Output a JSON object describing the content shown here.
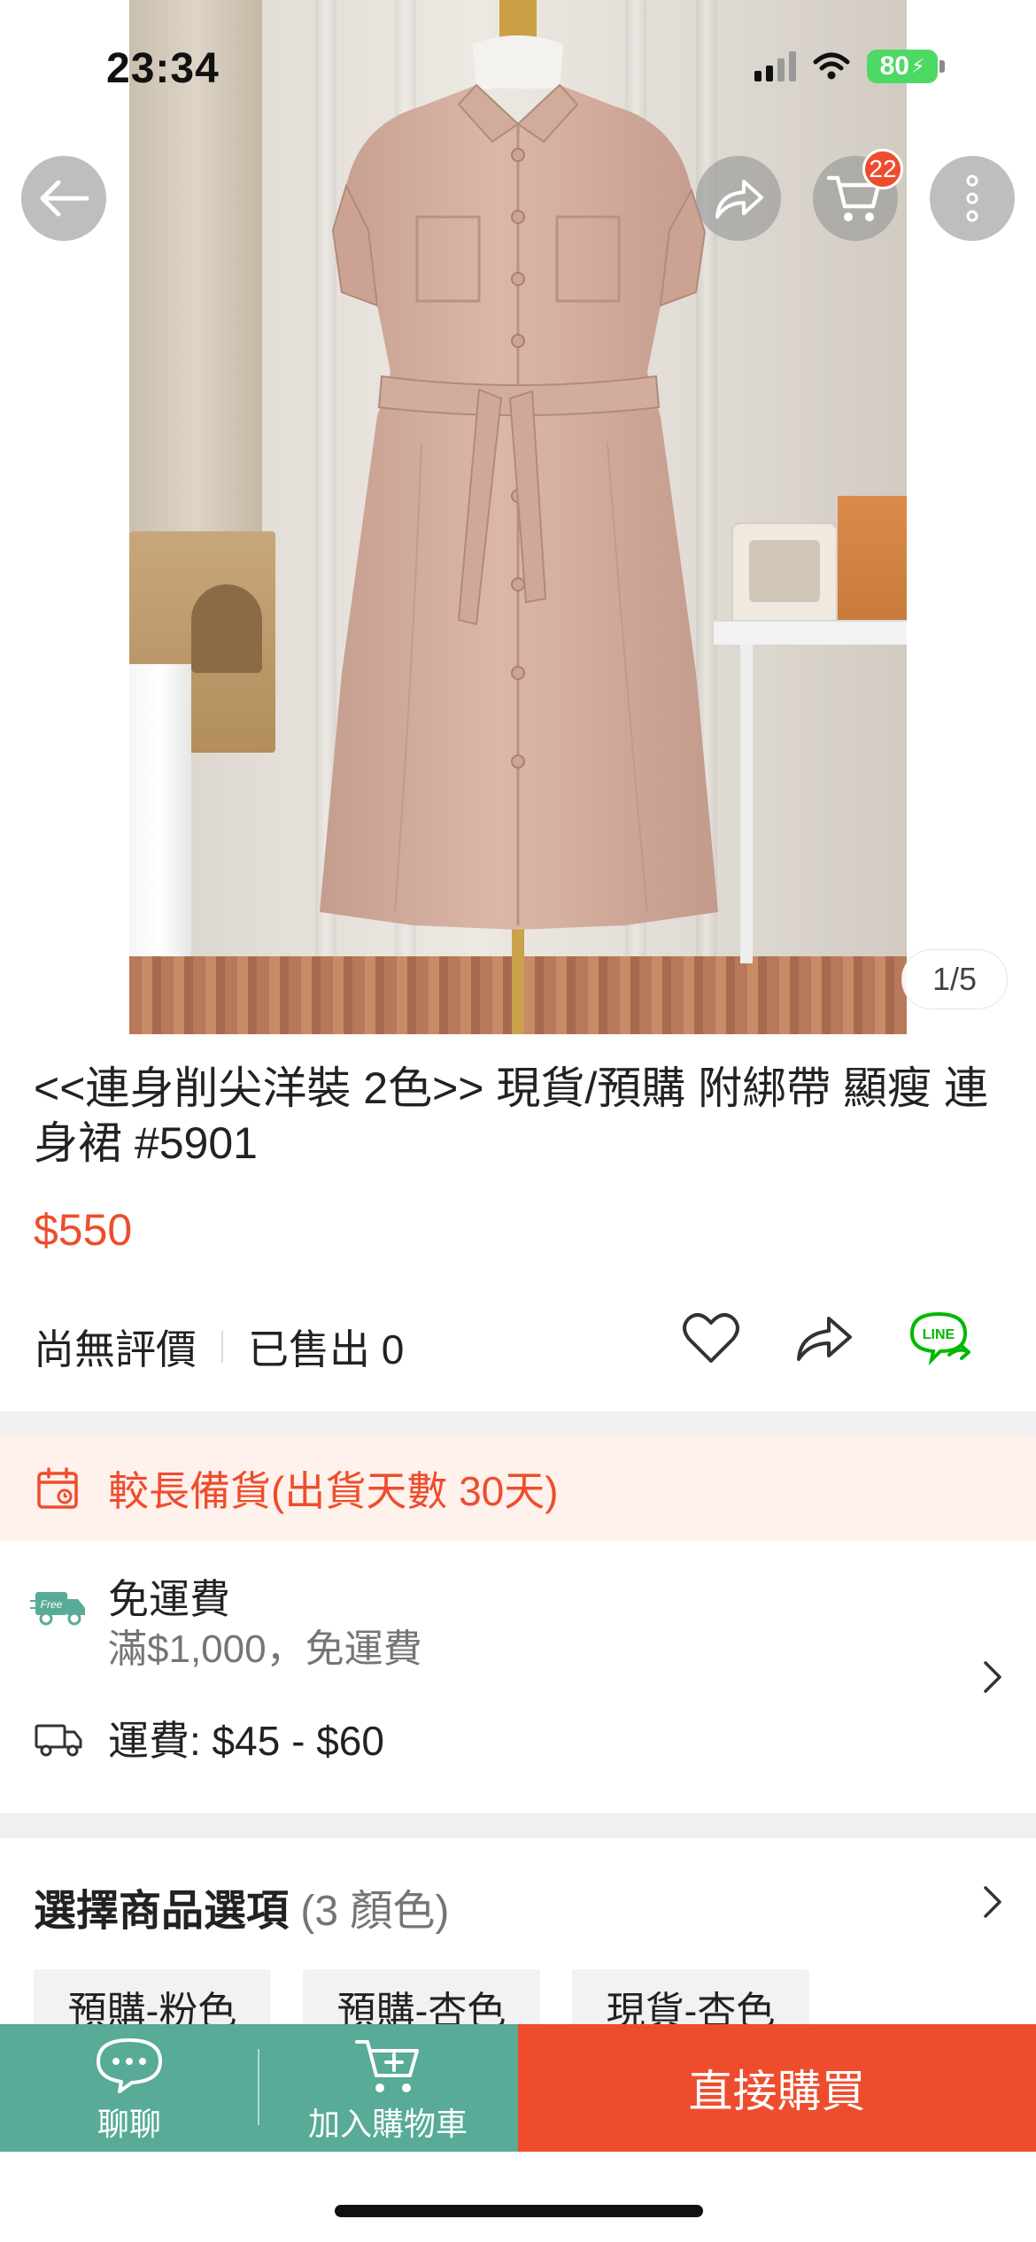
{
  "status_bar": {
    "time": "23:34",
    "battery": "80"
  },
  "header": {
    "cart_badge": "22"
  },
  "gallery": {
    "counter": "1/5"
  },
  "product": {
    "title": "<<連身削尖洋裝 2色>> 現貨/預購 附綁帶 顯瘦 連身裙 #5901",
    "price": "$550",
    "rating_text": "尚無評價",
    "sold_text": "已售出 0"
  },
  "notice": {
    "text": "較長備貨(出貨天數 30天)"
  },
  "shipping": {
    "free_badge": "Free",
    "free_title": "免運費",
    "free_subtitle": "滿$1,000，免運費",
    "fee_text": "運費: $45 - $60"
  },
  "options": {
    "title": "選擇商品選項",
    "count": "(3 顏色)",
    "chips": [
      "預購-粉色",
      "預購-杏色",
      "現貨-杏色"
    ]
  },
  "bottom_bar": {
    "chat_label": "聊聊",
    "add_cart_label": "加入購物車",
    "buy_label": "直接購買"
  },
  "icons": {
    "back": "arrow-left-icon",
    "share": "share-icon",
    "cart": "cart-icon",
    "more": "more-vertical-icon",
    "favorite": "heart-icon",
    "line": "line-share-icon",
    "calendar": "calendar-icon",
    "free_truck": "free-shipping-truck-icon",
    "truck": "truck-icon",
    "chevron": "chevron-right-icon",
    "chat": "chat-bubble-icon"
  },
  "colors": {
    "accent": "#ee4d2d",
    "chat_bar": "#57ab97",
    "line_green": "#00b900",
    "notice_bg": "#fff1ec"
  }
}
